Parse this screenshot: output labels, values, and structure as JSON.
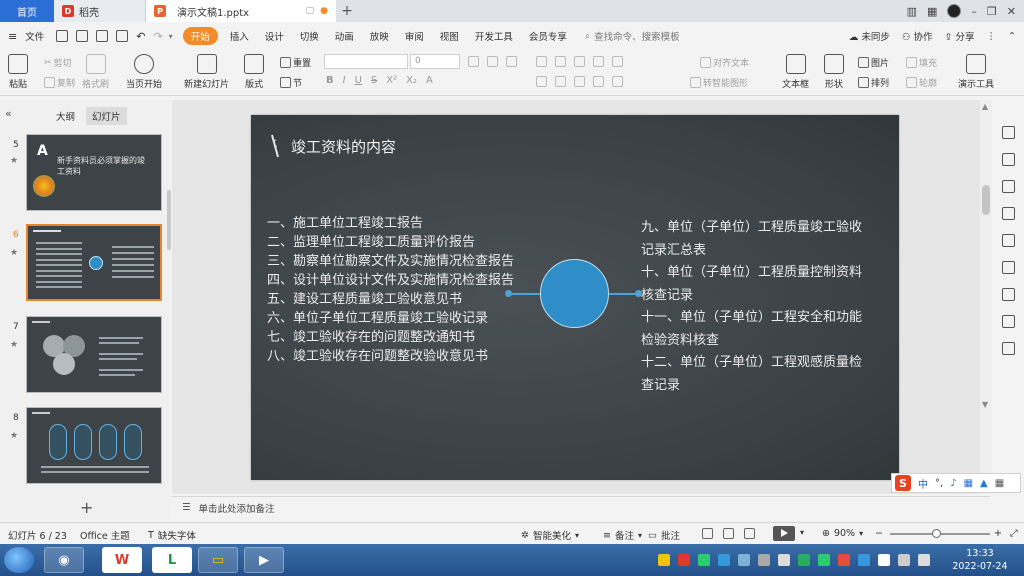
{
  "tabs": {
    "home": "首页",
    "daoke": "稻壳",
    "doc": "演示文稿1.pptx"
  },
  "menu": {
    "file": "文件",
    "items": [
      "开始",
      "插入",
      "设计",
      "切换",
      "动画",
      "放映",
      "审阅",
      "视图",
      "开发工具",
      "会员专享"
    ],
    "search": "查找命令、搜索模板",
    "unsynced": "未同步",
    "collab": "协作",
    "share": "分享"
  },
  "ribbon": {
    "paste": "粘贴",
    "cut": "剪切",
    "copy": "复制",
    "format_painter": "格式刷",
    "play_current": "当页开始",
    "new_slide": "新建幻灯片",
    "layout": "版式",
    "section": "节",
    "reset": "重置",
    "font_size": "0",
    "text_to_smartart": "转智能图形",
    "align_text": "对齐文本",
    "textbox": "文本框",
    "shape": "形状",
    "picture": "图片",
    "fill": "填充",
    "arrange": "排列",
    "outline": "轮廓",
    "presentation_tools": "演示工具"
  },
  "panel": {
    "tab_outline": "大纲",
    "tab_slides": "幻灯片",
    "thumbnails": [
      {
        "num": "5",
        "title": "新手资料员必须掌握的竣工资料"
      },
      {
        "num": "6",
        "title": "竣工资料的内容"
      },
      {
        "num": "7",
        "title": ""
      },
      {
        "num": "8",
        "title": ""
      }
    ],
    "current_index": 1
  },
  "slide": {
    "title": "竣工资料的内容",
    "left_items": [
      "一、施工单位工程竣工报告",
      "二、监理单位工程竣工质量评价报告",
      "三、勘察单位勘察文件及实施情况检查报告",
      "四、设计单位设计文件及实施情况检查报告",
      "五、建设工程质量竣工验收意见书",
      "六、单位子单位工程质量竣工验收记录",
      "七、竣工验收存在的问题整改通知书",
      "八、竣工验收存在问题整改验收意见书"
    ],
    "right_items": [
      "九、单位（子单位）工程质量竣工验收记录汇总表",
      "十、单位（子单位）工程质量控制资料核查记录",
      "十一、单位（子单位）工程安全和功能检验资料核查",
      "十二、单位（子单位）工程观感质量检查记录"
    ]
  },
  "notes": {
    "placeholder": "单击此处添加备注"
  },
  "status": {
    "slide_pos": "幻灯片 6 / 23",
    "theme": "Office 主题",
    "missing_font": "缺失字体",
    "smart_beautify": "智能美化",
    "notes_btn": "备注",
    "comment_btn": "批注",
    "zoom": "90%"
  },
  "ime": {
    "lang": "中"
  },
  "clock": {
    "time": "13:33",
    "date": "2022-07-24"
  },
  "colors": {
    "accent_orange": "#f28c28",
    "home_tab_blue": "#2b6fd6",
    "slide_bg": "#3f4549",
    "circle_blue": "#2f8ec8"
  }
}
